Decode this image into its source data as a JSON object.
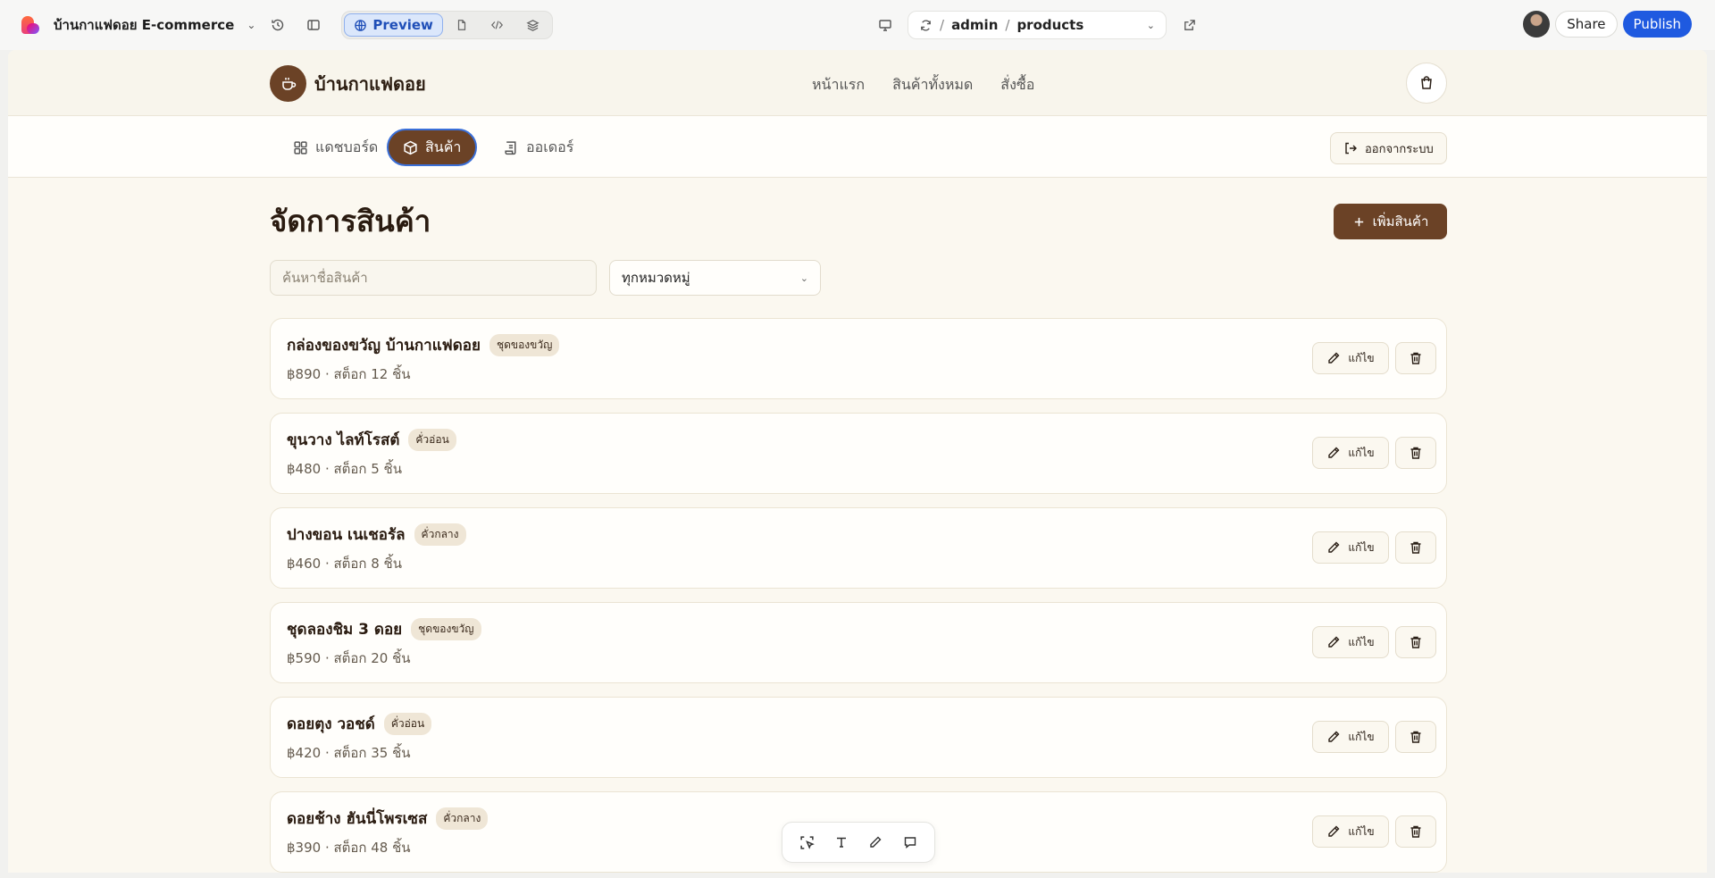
{
  "editor": {
    "project_name": "บ้านกาแฟดอย E-commerce",
    "preview_label": "Preview",
    "url_path": [
      "admin",
      "products"
    ],
    "share_label": "Share",
    "publish_label": "Publish"
  },
  "site": {
    "brand_name": "บ้านกาแฟดอย",
    "nav": [
      "หน้าแรก",
      "สินค้าทั้งหมด",
      "สั่งซื้อ"
    ]
  },
  "admin": {
    "tabs": [
      {
        "label": "แดชบอร์ด",
        "active": false
      },
      {
        "label": "สินค้า",
        "active": true
      },
      {
        "label": "ออเดอร์",
        "active": false
      }
    ],
    "logout_label": "ออกจากระบบ"
  },
  "main": {
    "title": "จัดการสินค้า",
    "add_label": "เพิ่มสินค้า",
    "search_placeholder": "ค้นหาชื่อสินค้า",
    "category_selected": "ทุกหมวดหมู่",
    "edit_label": "แก้ไข"
  },
  "products": [
    {
      "name": "กล่องของขวัญ บ้านกาแฟดอย",
      "badge": "ชุดของขวัญ",
      "meta": "฿890 · สต็อก 12 ชิ้น"
    },
    {
      "name": "ขุนวาง ไลท์โรสต์",
      "badge": "คั่วอ่อน",
      "meta": "฿480 · สต็อก 5 ชิ้น"
    },
    {
      "name": "ปางขอน เนเชอรัล",
      "badge": "คั่วกลาง",
      "meta": "฿460 · สต็อก 8 ชิ้น"
    },
    {
      "name": "ชุดลองชิม 3 ดอย",
      "badge": "ชุดของขวัญ",
      "meta": "฿590 · สต็อก 20 ชิ้น"
    },
    {
      "name": "ดอยตุง วอชด์",
      "badge": "คั่วอ่อน",
      "meta": "฿420 · สต็อก 35 ชิ้น"
    },
    {
      "name": "ดอยช้าง ฮันนี่โพรเซส",
      "badge": "คั่วกลาง",
      "meta": "฿390 · สต็อก 48 ชิ้น"
    }
  ],
  "colors": {
    "brand_brown": "#6b4226",
    "publish_blue": "#1f5ae0",
    "page_bg": "#fbf8f0"
  }
}
